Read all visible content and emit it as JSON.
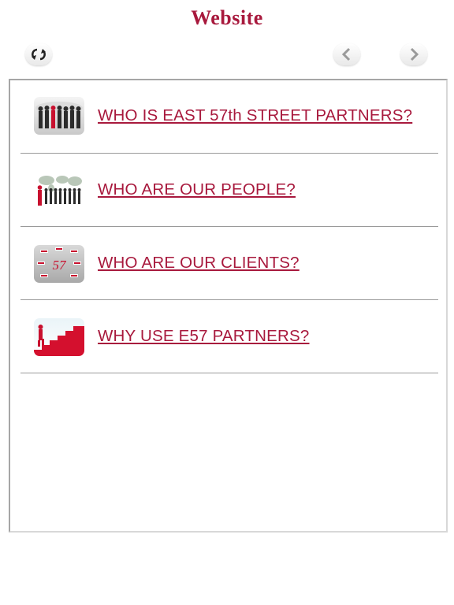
{
  "header": {
    "title": "Website"
  },
  "toolbar": {
    "refresh_icon": "refresh-icon",
    "back_icon": "chevron-left-icon",
    "forward_icon": "chevron-right-icon"
  },
  "menu": {
    "items": [
      {
        "label": "WHO IS EAST 57th STREET PARTNERS?",
        "icon": "business-team-thumbnail"
      },
      {
        "label": "WHO ARE OUR PEOPLE?",
        "icon": "people-world-map-thumbnail"
      },
      {
        "label": "WHO ARE OUR CLIENTS?",
        "icon": "e57-clients-thumbnail",
        "icon_text": "57"
      },
      {
        "label": "WHY USE E57 PARTNERS?",
        "icon": "stairs-thumbnail"
      }
    ]
  },
  "colors": {
    "accent": "#a8193d",
    "divider": "#9a9a9a"
  }
}
